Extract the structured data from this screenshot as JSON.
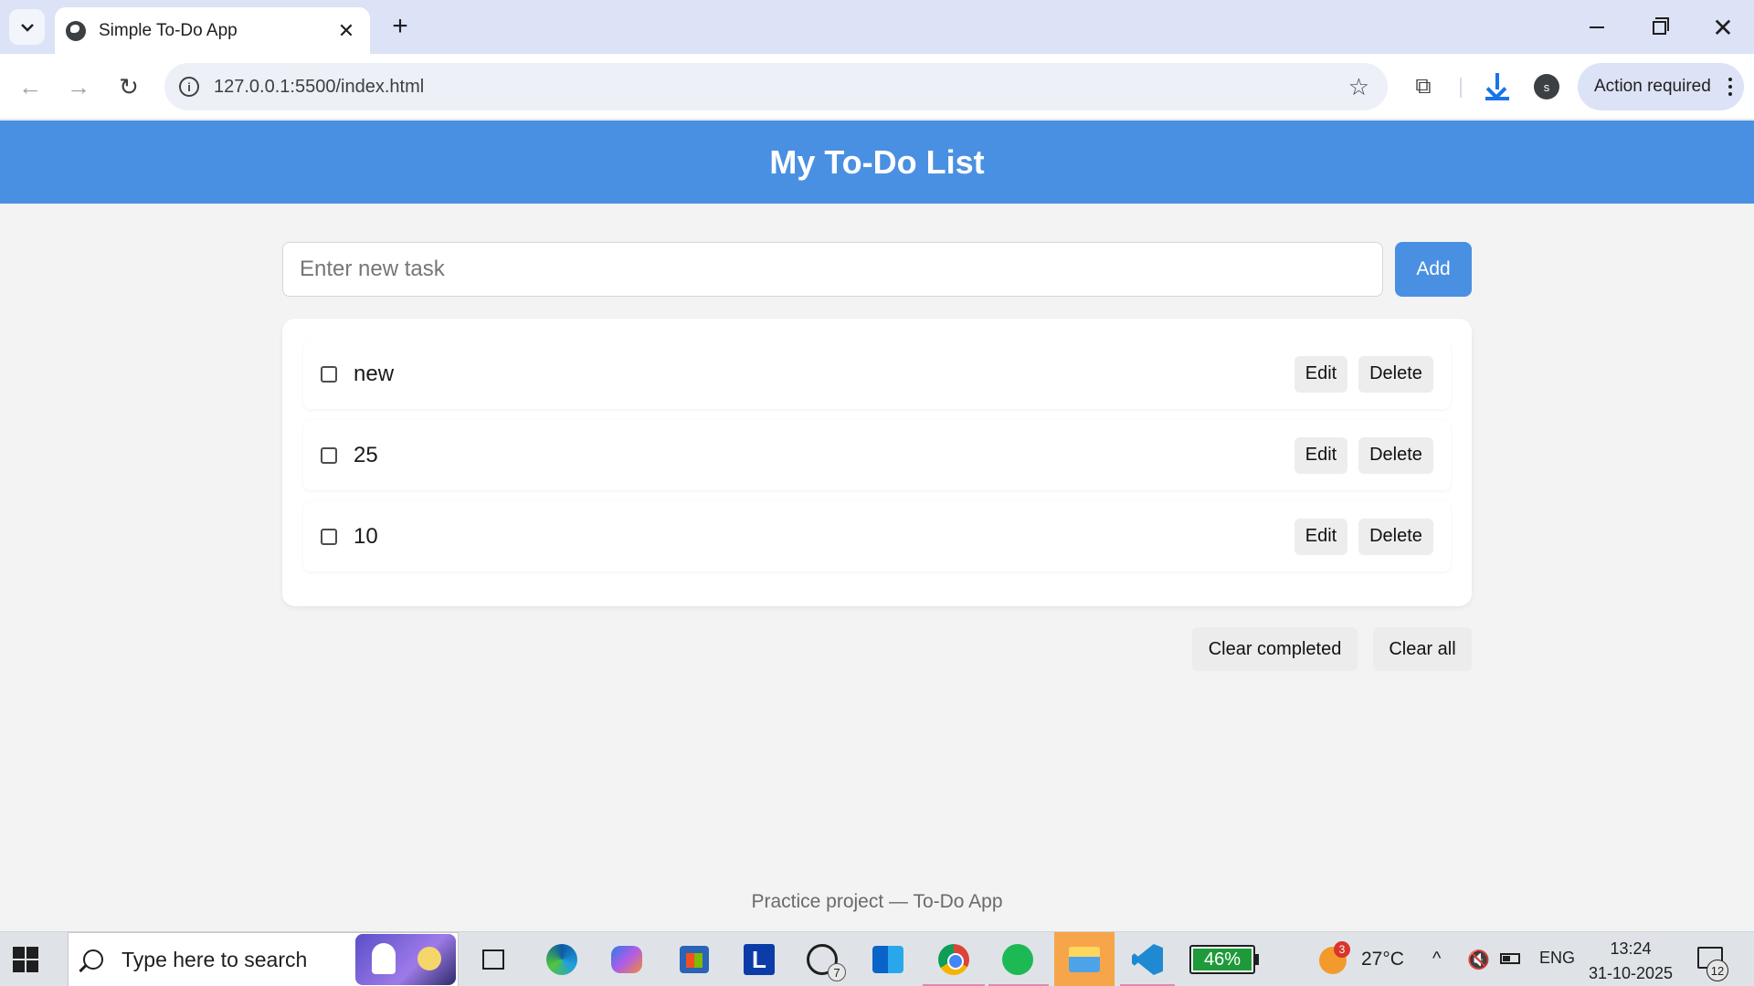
{
  "browser": {
    "tab_title": "Simple To-Do App",
    "tab_close": "✕",
    "new_tab": "+",
    "url": "127.0.0.1:5500/index.html",
    "info_icon": "i",
    "star_icon": "☆",
    "extensions_icon": "⧉",
    "profile_initial": "s",
    "action_required": "Action required",
    "window_close": "✕",
    "nav_back": "←",
    "nav_forward": "→",
    "nav_reload": "↻"
  },
  "app": {
    "title": "My To-Do List",
    "input": {
      "placeholder": "Enter new task",
      "value": ""
    },
    "add_label": "Add",
    "tasks": [
      {
        "text": "new",
        "done": false,
        "edit_label": "Edit",
        "delete_label": "Delete"
      },
      {
        "text": "25",
        "done": false,
        "edit_label": "Edit",
        "delete_label": "Delete"
      },
      {
        "text": "10",
        "done": false,
        "edit_label": "Edit",
        "delete_label": "Delete"
      }
    ],
    "clear_completed_label": "Clear completed",
    "clear_all_label": "Clear all",
    "footer": "Practice project — To-Do App"
  },
  "taskbar": {
    "search_placeholder": "Type here to search",
    "l_app_letter": "L",
    "whatsapp_badge": "7",
    "battery_percent": "46%",
    "weather_badge": "3",
    "weather_temp": "27°C",
    "tray_chevron": "^",
    "tray_volume": "🔇",
    "language": "ENG",
    "time": "13:24",
    "date": "31-10-2025",
    "notification_count": "12"
  },
  "colors": {
    "header_blue": "#4a90e2",
    "page_bg": "#f3f3f3",
    "battery_green": "#1f9a3a"
  }
}
